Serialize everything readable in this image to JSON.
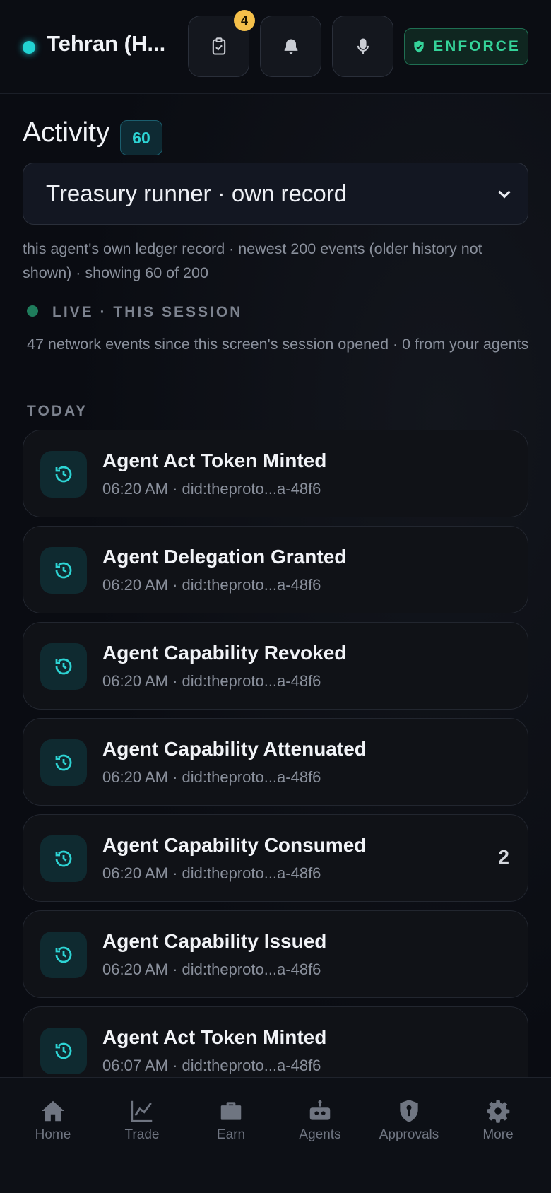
{
  "header": {
    "node_name": "Tehran (H...",
    "tasks_badge": "4",
    "enforce_label": "ENFORCE",
    "icons": [
      "clipboard-check-icon",
      "bell-icon",
      "microphone-icon",
      "shield-check-icon"
    ]
  },
  "activity": {
    "title": "Activity",
    "count": "60",
    "selector_value": "Treasury runner · own record",
    "description": "this agent's own ledger record · newest 200 events (older history not shown) · showing 60 of 200",
    "live_label": "LIVE · THIS SESSION",
    "live_text": "47 network events since this screen's session opened · 0 from your agents",
    "section": "TODAY"
  },
  "events": [
    {
      "title": "Agent Act Token Minted",
      "sub": "06:20 AM · did:theproto...a-48f6",
      "count": ""
    },
    {
      "title": "Agent Delegation Granted",
      "sub": "06:20 AM · did:theproto...a-48f6",
      "count": ""
    },
    {
      "title": "Agent Capability Revoked",
      "sub": "06:20 AM · did:theproto...a-48f6",
      "count": ""
    },
    {
      "title": "Agent Capability Attenuated",
      "sub": "06:20 AM · did:theproto...a-48f6",
      "count": ""
    },
    {
      "title": "Agent Capability Consumed",
      "sub": "06:20 AM · did:theproto...a-48f6",
      "count": "2"
    },
    {
      "title": "Agent Capability Issued",
      "sub": "06:20 AM · did:theproto...a-48f6",
      "count": ""
    },
    {
      "title": "Agent Act Token Minted",
      "sub": "06:07 AM · did:theproto...a-48f6",
      "count": ""
    }
  ],
  "nav": [
    {
      "label": "Home",
      "icon": "home-icon"
    },
    {
      "label": "Trade",
      "icon": "chart-line-icon"
    },
    {
      "label": "Earn",
      "icon": "briefcase-icon"
    },
    {
      "label": "Agents",
      "icon": "robot-icon"
    },
    {
      "label": "Approvals",
      "icon": "shield-key-icon"
    },
    {
      "label": "More",
      "icon": "gear-icon"
    }
  ],
  "colors": {
    "accent": "#22d3d3",
    "enforce": "#34d399",
    "badge": "#f5c04a",
    "background": "#0a0c12"
  }
}
